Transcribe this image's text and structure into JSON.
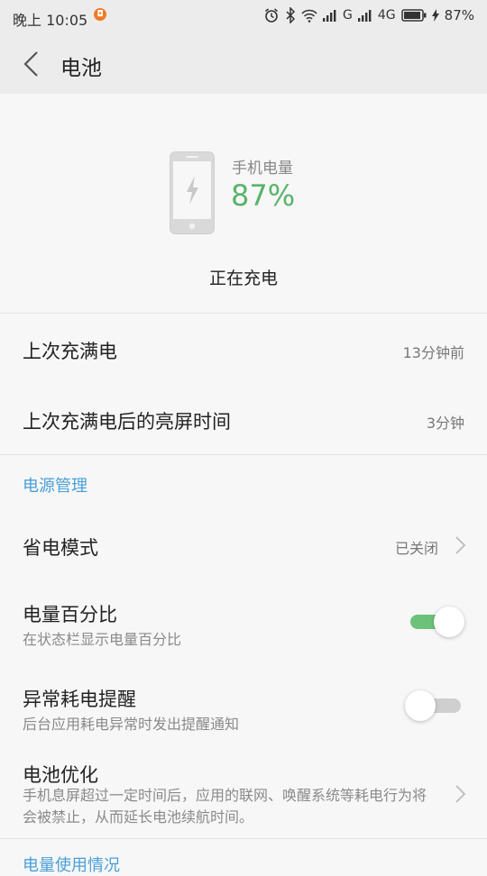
{
  "status_bar": {
    "time": "晚上 10:05",
    "network_g": "G",
    "network_4g": "4G",
    "battery_percent": "87%"
  },
  "app_bar": {
    "title": "电池"
  },
  "battery": {
    "capacity_label": "手机电量",
    "capacity_value": "87%",
    "state": "正在充电"
  },
  "last_full_charge": {
    "label": "上次充满电",
    "value": "13分钟前"
  },
  "screen_on_since_full": {
    "label": "上次充满电后的亮屏时间",
    "value": "3分钟"
  },
  "power_management": {
    "section_title": "电源管理",
    "power_saving": {
      "label": "省电模式",
      "value": "已关闭"
    },
    "battery_percentage": {
      "label": "电量百分比",
      "description": "在状态栏显示电量百分比",
      "enabled": true
    },
    "abnormal_drain_alert": {
      "label": "异常耗电提醒",
      "description": "后台应用耗电异常时发出提醒通知",
      "enabled": false
    },
    "battery_optimization": {
      "label": "电池优化",
      "description": "手机息屏超过一定时间后，应用的联网、唤醒系统等耗电行为将会被禁止，从而延长电池续航时间。"
    }
  },
  "usage_section_title": "电量使用情况",
  "colors": {
    "accent_green": "#59b36a",
    "section_blue": "#4a9fd8",
    "toggle_on": "#6cc27a",
    "toggle_off": "#cfcfcf"
  }
}
